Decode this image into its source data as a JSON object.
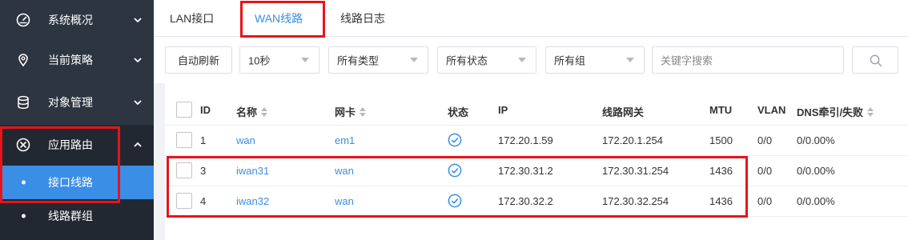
{
  "sidebar": {
    "items": [
      {
        "label": "系统概况",
        "icon": "dashboard-icon"
      },
      {
        "label": "当前策略",
        "icon": "location-pin-icon"
      },
      {
        "label": "对象管理",
        "icon": "database-icon"
      },
      {
        "label": "应用路由",
        "icon": "route-icon"
      }
    ],
    "sub_items": [
      {
        "label": "接口线路"
      },
      {
        "label": "线路群组"
      }
    ]
  },
  "tabs": [
    {
      "label": "LAN接口"
    },
    {
      "label": "WAN线路"
    },
    {
      "label": "线路日志"
    }
  ],
  "toolbar": {
    "auto_refresh_label": "自动刷新",
    "interval_value": "10秒",
    "type_value": "所有类型",
    "status_value": "所有状态",
    "group_value": "所有组",
    "search_placeholder": "关键字搜索"
  },
  "table": {
    "headers": {
      "id": "ID",
      "name": "名称",
      "nic": "网卡",
      "status": "状态",
      "ip": "IP",
      "gateway": "线路网关",
      "mtu": "MTU",
      "vlan": "VLAN",
      "dns": "DNS牵引/失败"
    },
    "rows": [
      {
        "id": "1",
        "name": "wan",
        "nic": "em1",
        "ip": "172.20.1.59",
        "gateway": "172.20.1.254",
        "mtu": "1500",
        "vlan": "0/0",
        "dns": "0/0.00%"
      },
      {
        "id": "3",
        "name": "iwan31",
        "nic": "wan",
        "ip": "172.30.31.2",
        "gateway": "172.30.31.254",
        "mtu": "1436",
        "vlan": "0/0",
        "dns": "0/0.00%"
      },
      {
        "id": "4",
        "name": "iwan32",
        "nic": "wan",
        "ip": "172.30.32.2",
        "gateway": "172.30.32.254",
        "mtu": "1436",
        "vlan": "0/0",
        "dns": "0/0.00%"
      }
    ]
  },
  "colors": {
    "sidebar_bg": "#2d3541",
    "accent": "#3a8ee6",
    "highlight_border": "#e8141a"
  }
}
